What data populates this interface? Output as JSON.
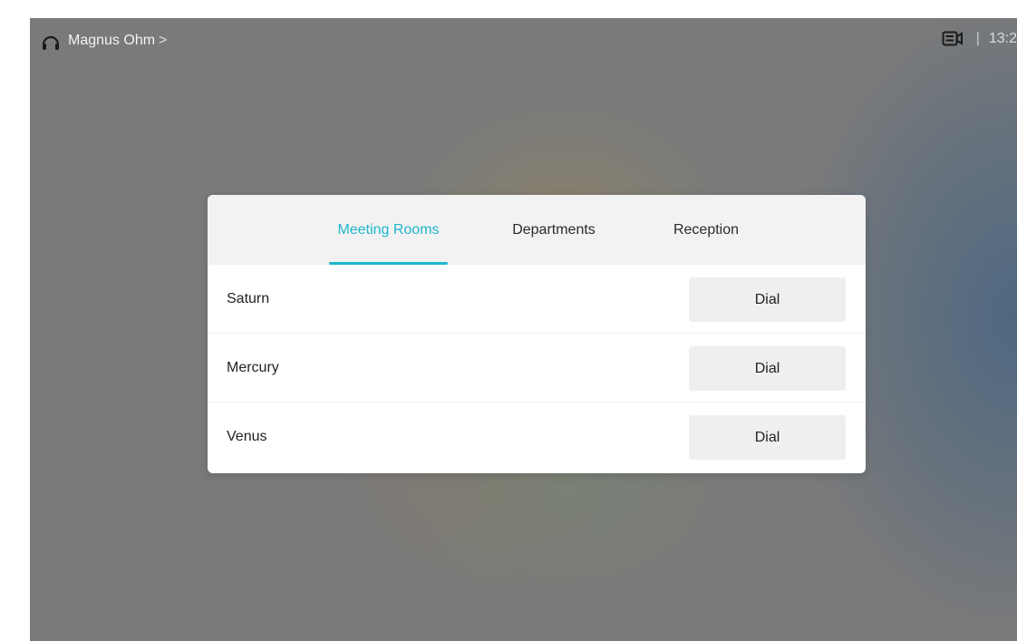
{
  "status_bar": {
    "user_name": "Magnus Ohm",
    "chevron": ">",
    "separator": "|",
    "time": "13:2"
  },
  "icons": {
    "user": "headset-icon",
    "camera": "camera-status-icon"
  },
  "colors": {
    "accent": "#1eb6cc",
    "background": "#7a7a7a"
  },
  "tabs": [
    {
      "label": "Meeting Rooms",
      "active": true
    },
    {
      "label": "Departments",
      "active": false
    },
    {
      "label": "Reception",
      "active": false
    }
  ],
  "rooms": [
    {
      "name": "Saturn",
      "action": "Dial"
    },
    {
      "name": "Mercury",
      "action": "Dial"
    },
    {
      "name": "Venus",
      "action": "Dial"
    }
  ]
}
